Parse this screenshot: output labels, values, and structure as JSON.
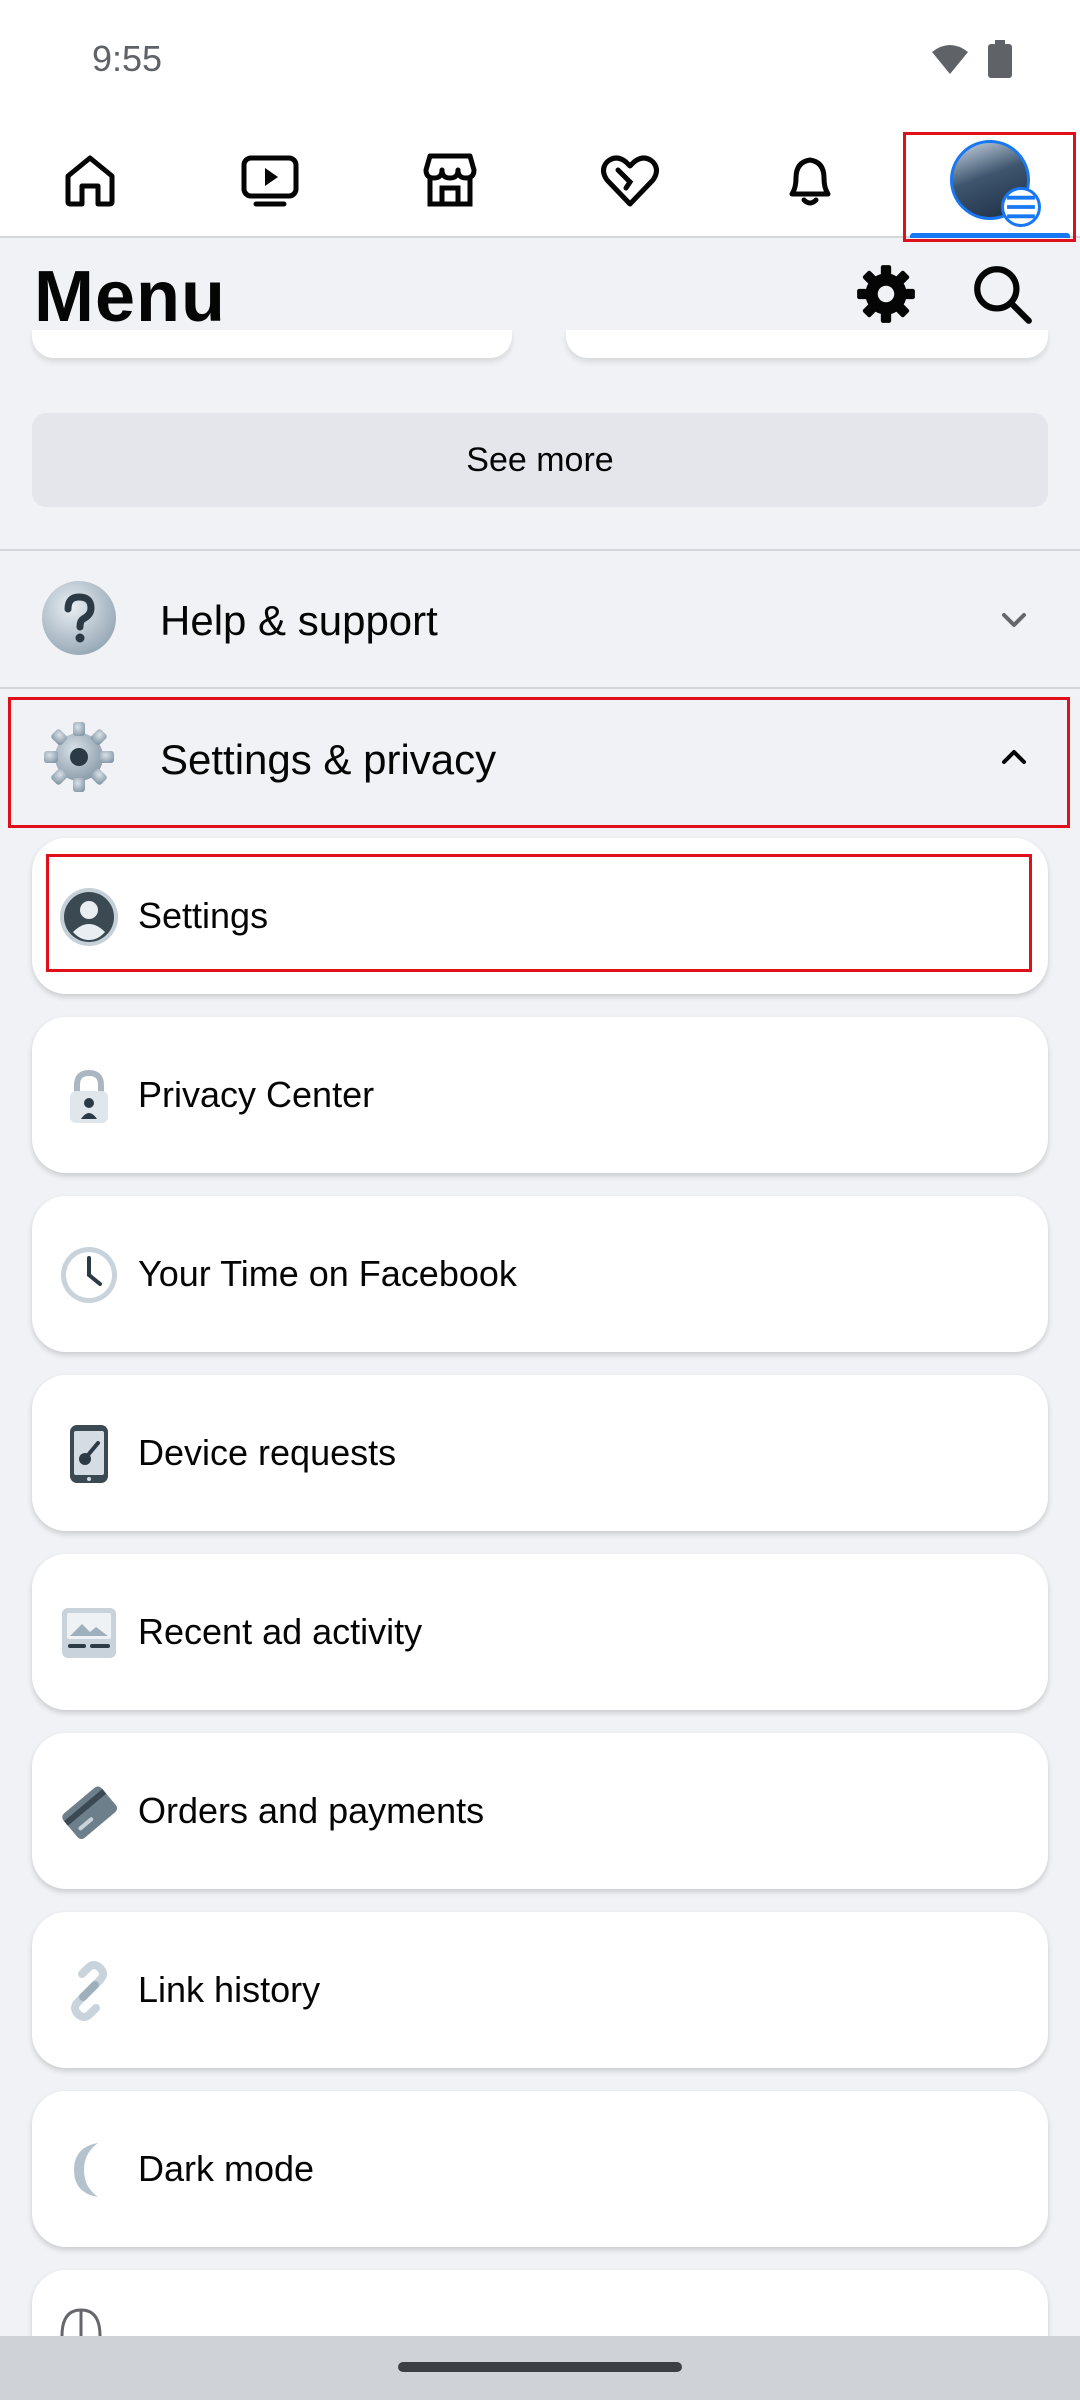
{
  "status_bar": {
    "time": "9:55"
  },
  "nav": {
    "tabs": [
      {
        "name": "home"
      },
      {
        "name": "video"
      },
      {
        "name": "marketplace"
      },
      {
        "name": "dating"
      },
      {
        "name": "notifications"
      },
      {
        "name": "menu",
        "active": true
      }
    ]
  },
  "header": {
    "title": "Menu"
  },
  "see_more_label": "See more",
  "sections": {
    "help": {
      "label": "Help & support"
    },
    "settings": {
      "label": "Settings & privacy"
    }
  },
  "settings_items": [
    {
      "label": "Settings",
      "icon": "person-circle-icon"
    },
    {
      "label": "Privacy Center",
      "icon": "lock-person-icon"
    },
    {
      "label": "Your Time on Facebook",
      "icon": "clock-icon"
    },
    {
      "label": "Device requests",
      "icon": "phone-key-icon"
    },
    {
      "label": "Recent ad activity",
      "icon": "ad-image-icon"
    },
    {
      "label": "Orders and payments",
      "icon": "card-icon"
    },
    {
      "label": "Link history",
      "icon": "link-icon"
    },
    {
      "label": "Dark mode",
      "icon": "moon-icon"
    }
  ],
  "colors": {
    "accent": "#1877f2",
    "highlight": "#e0101a",
    "background": "#f0f2f5"
  }
}
